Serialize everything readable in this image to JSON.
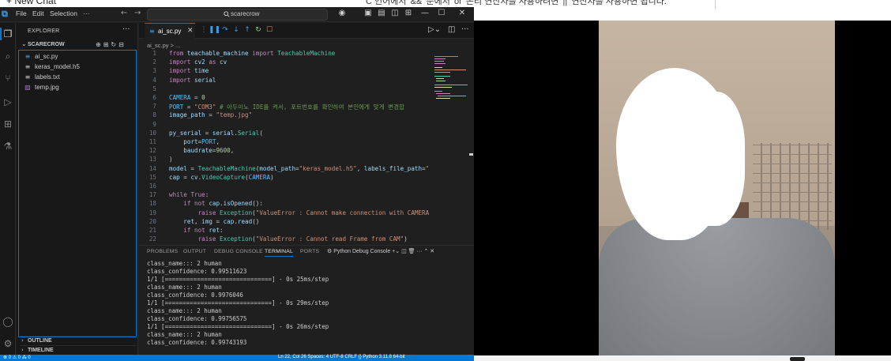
{
  "background_page": {
    "new_chat": "+ New Chat",
    "korean_snippet": "C 언어에서 '&&' 문에서 'or' 논리 연산자를 사용하려면 '||' 연산자를 사용하면 됩니다."
  },
  "titlebar": {
    "menus": [
      "File",
      "Edit",
      "Selection",
      "···"
    ],
    "search_placeholder": "scarecrow",
    "controls": [
      "—",
      "☐",
      "✕"
    ]
  },
  "activity_bar": {
    "icons": [
      "files-icon",
      "search-icon",
      "source-control-icon",
      "run-debug-icon",
      "extensions-icon",
      "testing-icon",
      "account-icon",
      "settings-icon"
    ]
  },
  "sidebar": {
    "title": "EXPLORER",
    "folder": "SCARECROW",
    "files": [
      {
        "name": "ai_sc.py",
        "icon": "python-file-icon",
        "color": "#3b9de8"
      },
      {
        "name": "keras_model.h5",
        "icon": "file-icon",
        "color": "#cccccc"
      },
      {
        "name": "labels.txt",
        "icon": "text-file-icon",
        "color": "#cccccc"
      },
      {
        "name": "temp.jpg",
        "icon": "image-file-icon",
        "color": "#a074c4"
      }
    ],
    "sections": [
      "OUTLINE",
      "TIMELINE"
    ]
  },
  "editor": {
    "tab_label": "ai_sc.py",
    "breadcrumb": "ai_sc.py > ...",
    "code_lines": [
      {
        "n": "1",
        "t": "from teachable_machine import TeachableMachine"
      },
      {
        "n": "2",
        "t": "import cv2 as cv"
      },
      {
        "n": "3",
        "t": "import time"
      },
      {
        "n": "4",
        "t": "import serial"
      },
      {
        "n": "5",
        "t": ""
      },
      {
        "n": "6",
        "t": "CAMERA = 0"
      },
      {
        "n": "7",
        "t": "PORT = \"COM3\" # 아두이노 IDE를 켜서, 포트번호를 확인하여 본인에게 맞게 변경합"
      },
      {
        "n": "8",
        "t": "image_path = \"temp.jpg\""
      },
      {
        "n": "9",
        "t": ""
      },
      {
        "n": "10",
        "t": "py_serial = serial.Serial("
      },
      {
        "n": "11",
        "t": "    port=PORT,"
      },
      {
        "n": "12",
        "t": "    baudrate=9600,"
      },
      {
        "n": "13",
        "t": ")"
      },
      {
        "n": "14",
        "t": "model = TeachableMachine(model_path=\"keras_model.h5\", labels_file_path=\""
      },
      {
        "n": "15",
        "t": "cap = cv.VideoCapture(CAMERA)"
      },
      {
        "n": "16",
        "t": ""
      },
      {
        "n": "17",
        "t": "while True:"
      },
      {
        "n": "18",
        "t": "    if not cap.isOpened():"
      },
      {
        "n": "19",
        "t": "        raise Exception(\"ValueError : Cannot make connection with CAMERA"
      },
      {
        "n": "20",
        "t": "    ret, img = cap.read()"
      },
      {
        "n": "21",
        "t": "    if not ret:"
      },
      {
        "n": "22",
        "t": "        raise Exception(\"ValueError : Cannot read Frame from CAM\")"
      }
    ]
  },
  "panel": {
    "tabs": [
      "PROBLEMS",
      "OUTPUT",
      "DEBUG CONSOLE",
      "TERMINAL",
      "PORTS"
    ],
    "active_tab": "TERMINAL",
    "terminal_name": "Python Debug Console",
    "terminal_lines": [
      "class_name::: 2 human",
      "class_confidence: 0.99511623",
      "1/1 [==============================] - 0s 25ms/step",
      "class_name::: 2 human",
      "class_confidence: 0.9976046",
      "1/1 [==============================] - 0s 29ms/step",
      "class_name::: 2 human",
      "class_confidence: 0.99756575",
      "1/1 [==============================] - 0s 26ms/step",
      "class_name::: 2 human",
      "class_confidence: 0.99743193"
    ]
  },
  "statusbar": {
    "left": "⊗ 0 ⚠ 0   ⁂ 0",
    "right": "Ln 22, Col 26   Spaces: 4   UTF-8   CRLF   {} Python   3.11.8 64-bit"
  }
}
